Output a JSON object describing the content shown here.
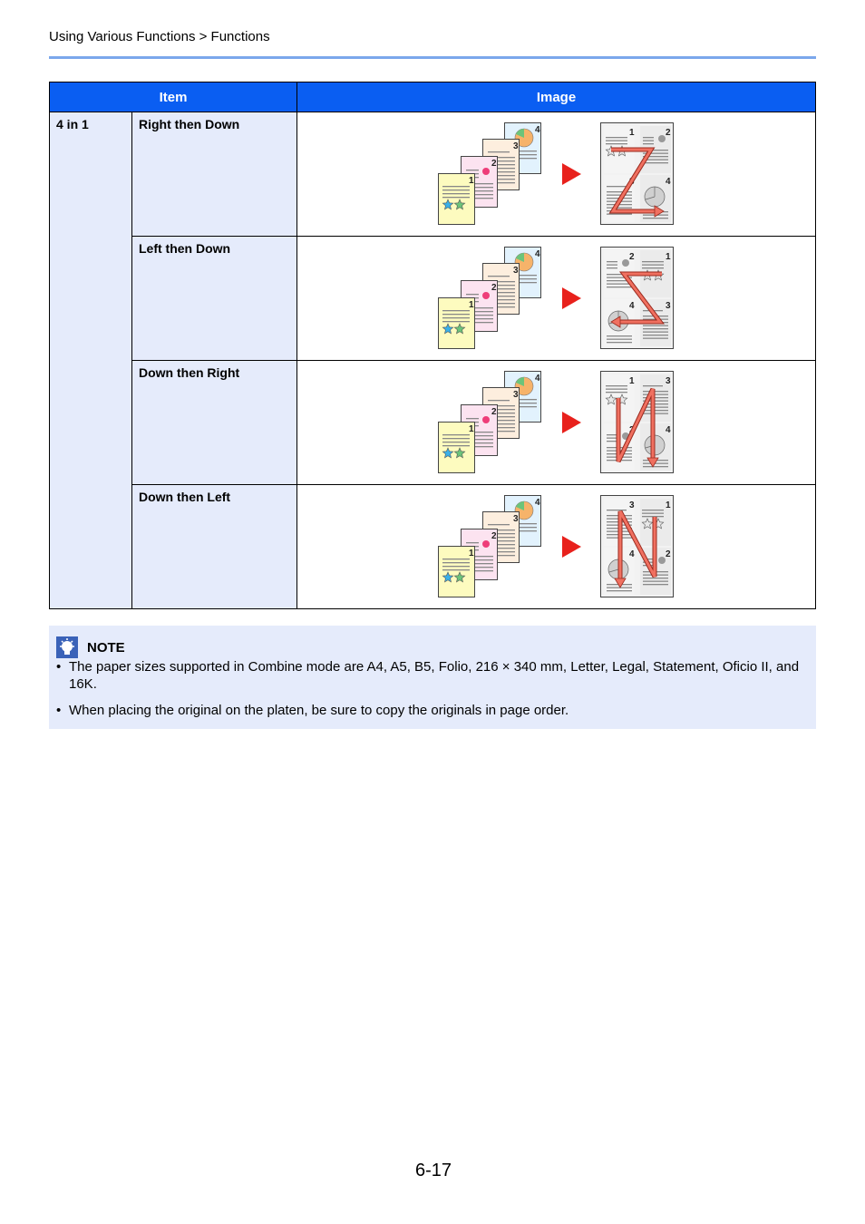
{
  "header": {
    "breadcrumb": "Using Various Functions > Functions"
  },
  "table": {
    "columns": [
      "Item",
      "Image"
    ],
    "category": "4 in 1",
    "rows": [
      {
        "label": "Right then Down",
        "layout": [
          "1",
          "2",
          "3",
          "4"
        ],
        "path": "z-right"
      },
      {
        "label": "Left then Down",
        "layout": [
          "2",
          "1",
          "4",
          "3"
        ],
        "path": "z-left"
      },
      {
        "label": "Down then Right",
        "layout": [
          "1",
          "3",
          "2",
          "4"
        ],
        "path": "n-right"
      },
      {
        "label": "Down then Left",
        "layout": [
          "3",
          "1",
          "4",
          "2"
        ],
        "path": "n-left"
      }
    ],
    "original_pages": [
      "1",
      "2",
      "3",
      "4"
    ]
  },
  "colors": {
    "header_bg": "#0a5ef2",
    "cell_bg": "#e5ebfb",
    "rule": "#7ba7ec",
    "arrow": "#e8211c",
    "path": "#f07060",
    "page1": "#fdfbbf",
    "page2": "#fce3f0",
    "page3": "#fdeede",
    "page4": "#e2f2fd"
  },
  "note": {
    "icon": "lightbulb-note-icon",
    "title": "NOTE",
    "items": [
      "The paper sizes supported in Combine mode are A4, A5, B5, Folio, 216 × 340 mm, Letter, Legal, Statement, Oficio II, and 16K.",
      "When placing the original on the platen, be sure to copy the originals in page order."
    ]
  },
  "footer": {
    "page_number": "6-17"
  }
}
